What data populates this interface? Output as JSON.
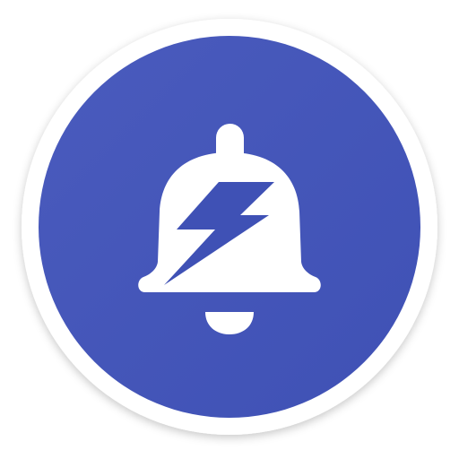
{
  "app_icon": {
    "icon_name": "bell-lightning-icon",
    "colors": {
      "page_background": "#ffffff",
      "outer_ring": "#ffffff",
      "circle_fill": "#3f51b5",
      "circle_fill_highlight": "#4a5bbd",
      "bell": "#ffffff",
      "bolt": "#3f51b5"
    }
  }
}
